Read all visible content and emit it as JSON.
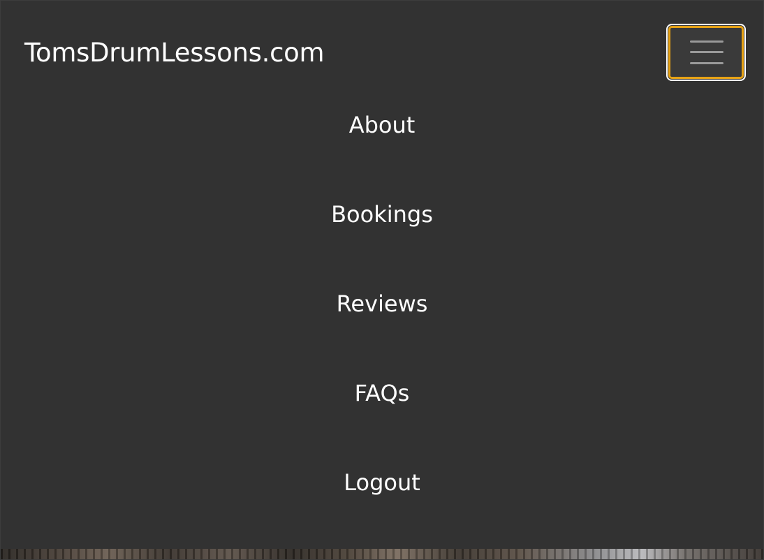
{
  "navbar": {
    "brand": "TomsDrumLessons.com",
    "toggler_icon": "hamburger-menu-icon",
    "toggler_focus_color": "#e6a215",
    "background_color": "#323232",
    "menu": [
      {
        "label": "About"
      },
      {
        "label": "Bookings"
      },
      {
        "label": "Reviews"
      },
      {
        "label": "FAQs"
      },
      {
        "label": "Logout"
      }
    ]
  },
  "hero": {
    "image": "drum-kit-photo"
  }
}
